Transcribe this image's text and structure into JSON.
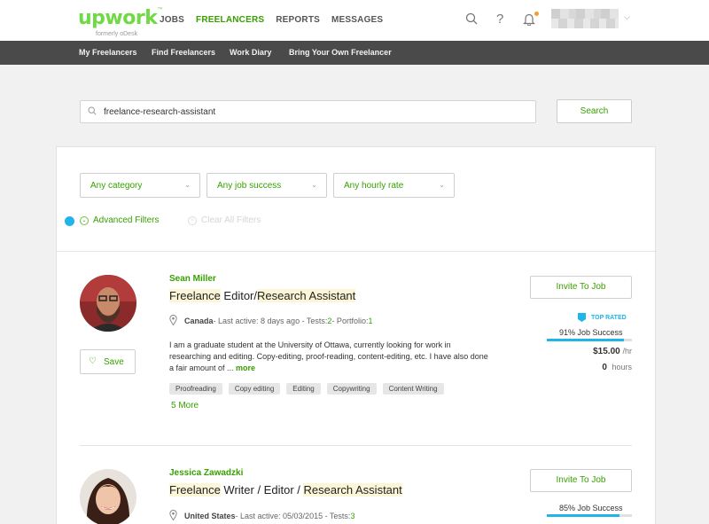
{
  "header": {
    "logo_text": "upwork",
    "logo_tm": "™",
    "logo_formerly": "formerly oDesk",
    "nav": [
      {
        "label": "JOBS"
      },
      {
        "label": "FREELANCERS"
      },
      {
        "label": "REPORTS"
      },
      {
        "label": "MESSAGES"
      }
    ],
    "help_glyph": "?",
    "accent_color": "#37a000",
    "notification_dot_color": "#f0a030"
  },
  "subnav": {
    "items": [
      {
        "label": "My Freelancers"
      },
      {
        "label": "Find Freelancers"
      },
      {
        "label": "Work Diary"
      },
      {
        "label": "Bring Your Own Freelancer"
      }
    ]
  },
  "search": {
    "value": "freelance-research-assistant",
    "button_label": "Search"
  },
  "filters": {
    "category": "Any category",
    "job_success": "Any job success",
    "hourly_rate": "Any hourly rate",
    "advanced": "Advanced Filters",
    "clear_all": "Clear All Filters"
  },
  "freelancers": [
    {
      "name": "Sean Miller",
      "title_parts": [
        "Freelance",
        " Editor/",
        "Research Assistant"
      ],
      "location": "Canada",
      "last_active": " - Last active: 8 days ago - Tests: ",
      "tests": "2",
      "portfolio_label": " - Portfolio: ",
      "portfolio": "1",
      "bio": "I am a graduate student at the University of Ottawa, currently looking for work in researching and editing. Copy-editing, proof-reading, content-editing, etc. I have also done a fair amount of ... ",
      "bio_more": "more",
      "tags": [
        "Proofreading",
        "Copy editing",
        "Editing",
        "Copywriting",
        "Content Writing"
      ],
      "more_tags": "5 More",
      "invite_label": "Invite To Job",
      "save_label": "Save",
      "badge": "TOP RATED",
      "job_success": "91% Job Success",
      "job_success_pct": 91,
      "rate": "$15.00",
      "rate_unit": "/hr",
      "hours": "0",
      "hours_label": "hours"
    },
    {
      "name": "Jessica Zawadzki",
      "title_parts": [
        "Freelance",
        " Writer / Editor / ",
        "Research Assistant"
      ],
      "location": "United States",
      "last_active": " - Last active: 05/03/2015 - Tests: ",
      "tests": "3",
      "invite_label": "Invite To Job",
      "job_success": "85% Job Success",
      "job_success_pct": 85
    }
  ]
}
